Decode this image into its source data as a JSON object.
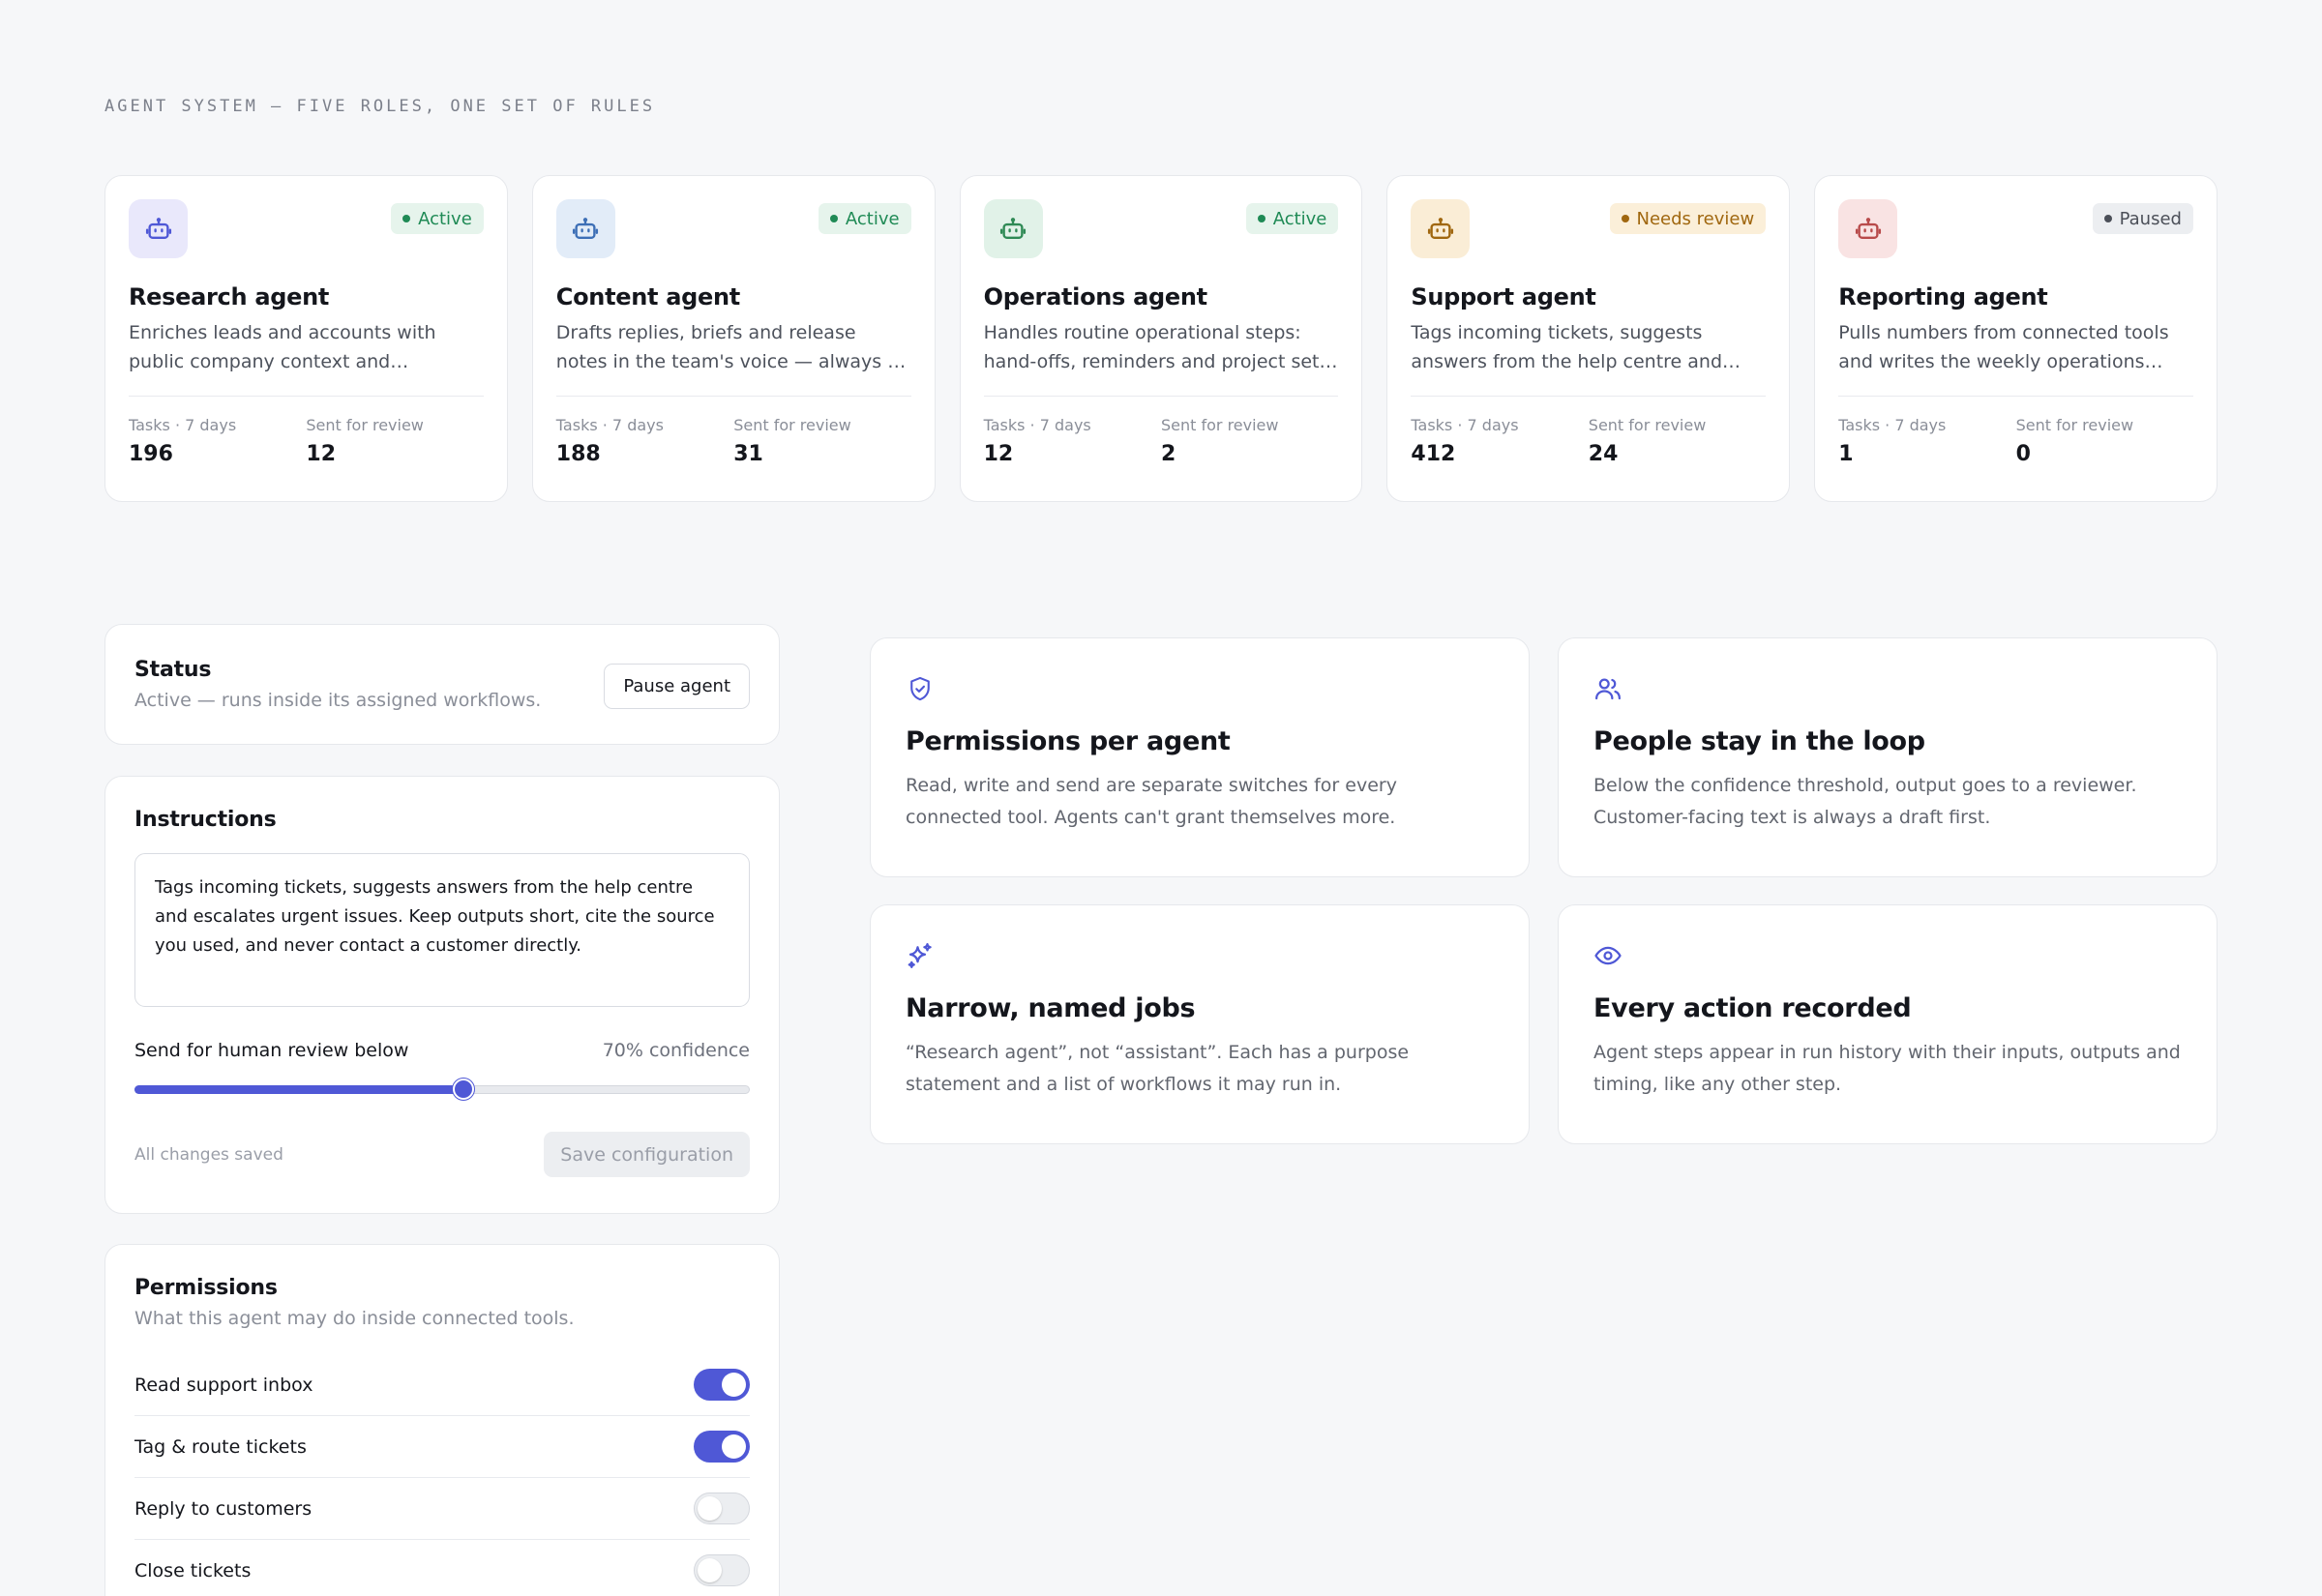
{
  "eyebrow": "AGENT SYSTEM — FIVE ROLES, ONE SET OF RULES",
  "colors": {
    "accent": "#4f58d6",
    "active": "#1f8a55",
    "review": "#a0670f",
    "paused": "#4b4f58"
  },
  "agents": [
    {
      "name": "Research agent",
      "status": "Active",
      "icon": "robot-icon",
      "description": "Enriches leads and accounts with public company context and summarises findings for the team.",
      "tasks_label": "Tasks · 7 days",
      "tasks": "196",
      "review_label": "Sent for review",
      "review": "12"
    },
    {
      "name": "Content agent",
      "status": "Active",
      "icon": "robot-icon",
      "description": "Drafts replies, briefs and release notes in the team's voice — always as drafts.",
      "tasks_label": "Tasks · 7 days",
      "tasks": "188",
      "review_label": "Sent for review",
      "review": "31"
    },
    {
      "name": "Operations agent",
      "status": "Active",
      "icon": "robot-icon",
      "description": "Handles routine operational steps: hand-offs, reminders and project set-up across tools.",
      "tasks_label": "Tasks · 7 days",
      "tasks": "12",
      "review_label": "Sent for review",
      "review": "2"
    },
    {
      "name": "Support agent",
      "status": "Needs review",
      "icon": "robot-icon",
      "description": "Tags incoming tickets, suggests answers from the help centre and escalates urgent issues.",
      "tasks_label": "Tasks · 7 days",
      "tasks": "412",
      "review_label": "Sent for review",
      "review": "24"
    },
    {
      "name": "Reporting agent",
      "status": "Paused",
      "icon": "robot-icon",
      "description": "Pulls numbers from connected tools and writes the weekly operations summary.",
      "tasks_label": "Tasks · 7 days",
      "tasks": "1",
      "review_label": "Sent for review",
      "review": "0"
    }
  ],
  "status_panel": {
    "title": "Status",
    "subtitle": "Active — runs inside its assigned workflows.",
    "pause_button": "Pause agent"
  },
  "instructions_panel": {
    "title": "Instructions",
    "text": "Tags incoming tickets, suggests answers from the help centre and escalates urgent issues. Keep outputs short, cite the source you used, and never contact a customer directly.",
    "slider_label": "Send for human review below",
    "slider_value": 0.7,
    "slider_value_text": "70% confidence",
    "saved_text": "All changes saved",
    "save_button": "Save configuration"
  },
  "permissions_panel": {
    "title": "Permissions",
    "subtitle": "What this agent may do inside connected tools.",
    "items": [
      {
        "label": "Read support inbox",
        "enabled": true
      },
      {
        "label": "Tag & route tickets",
        "enabled": true
      },
      {
        "label": "Reply to customers",
        "enabled": false
      },
      {
        "label": "Close tickets",
        "enabled": false
      }
    ]
  },
  "features": [
    {
      "icon": "shield-check-icon",
      "title": "Permissions per agent",
      "description": "Read, write and send are separate switches for every connected tool. Agents can't grant themselves more."
    },
    {
      "icon": "users-icon",
      "title": "People stay in the loop",
      "description": "Below the confidence threshold, output goes to a reviewer. Customer-facing text is always a draft first."
    },
    {
      "icon": "sparkles-icon",
      "title": "Narrow, named jobs",
      "description": "“Research agent”, not “assistant”. Each has a purpose statement and a list of workflows it may run in."
    },
    {
      "icon": "eye-icon",
      "title": "Every action recorded",
      "description": "Agent steps appear in run history with their inputs, outputs and timing, like any other step."
    }
  ]
}
